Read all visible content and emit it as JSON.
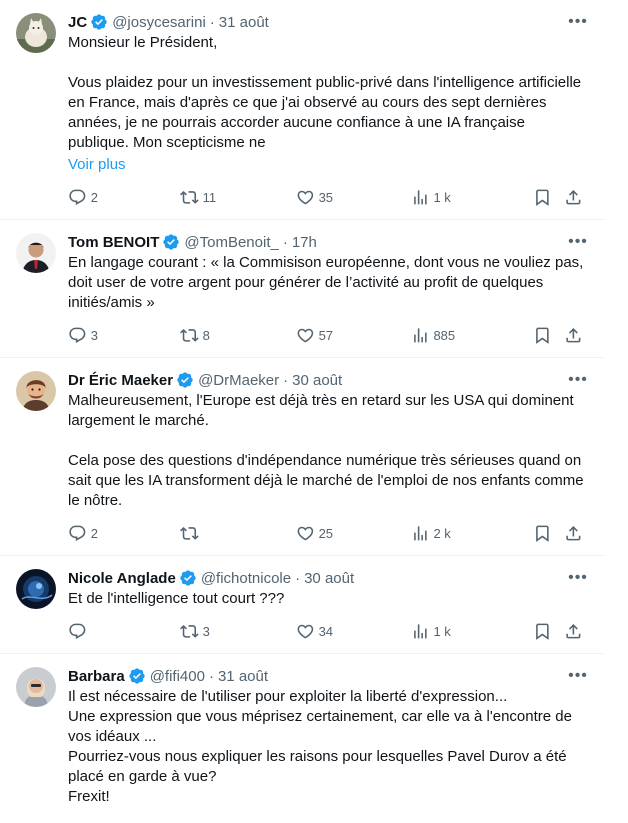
{
  "tweets": [
    {
      "name": "JC",
      "handle": "@josycesarini",
      "dot": "·",
      "time": "31 août",
      "text": "Monsieur le Président,\n\nVous plaidez pour un investissement public-privé dans l'intelligence artificielle en France, mais d'après ce que j'ai observé au cours des sept dernières années, je ne pourrais accorder aucune confiance à une IA française publique. Mon scepticisme ne",
      "show_more": "Voir plus",
      "replies": "2",
      "reposts": "11",
      "likes": "35",
      "views": "1 k",
      "avatar_icon": "cat-photo-avatar"
    },
    {
      "name": "Tom BENOIT",
      "handle": "@TomBenoit_",
      "dot": "·",
      "time": "17h",
      "text": "En langage courant : « la Commisison européenne, dont vous ne vouliez pas, doit user de votre argent pour générer de l’activité au profit de quelques initiés/amis »",
      "replies": "3",
      "reposts": "8",
      "likes": "57",
      "views": "885",
      "avatar_icon": "man-portrait-avatar"
    },
    {
      "name": "Dr Éric Maeker",
      "handle": "@DrMaeker",
      "dot": "·",
      "time": "30 août",
      "text": "Malheureusement, l'Europe est déjà très en retard sur les USA qui dominent largement le marché.\n\nCela pose des questions d'indépendance numérique très sérieuses quand on sait que les IA transforment déjà le marché de l'emploi de nos enfants comme le nôtre.",
      "replies": "2",
      "reposts": "",
      "likes": "25",
      "views": "2 k",
      "avatar_icon": "cartoon-man-avatar"
    },
    {
      "name": "Nicole Anglade",
      "handle": "@fichotnicole",
      "dot": "·",
      "time": "30 août",
      "text": "Et de l'intelligence tout court ???",
      "replies": "",
      "reposts": "3",
      "likes": "34",
      "views": "1 k",
      "avatar_icon": "dark-blue-avatar"
    },
    {
      "name": "Barbara",
      "handle": "@fifi400",
      "dot": "·",
      "time": "31 août",
      "text": "Il est nécessaire de l'utiliser pour exploiter la liberté d'expression...\nUne expression que vous méprisez certainement, car elle va à l'encontre de vos idéaux ...\nPourriez-vous nous expliquer les raisons pour lesquelles Pavel Durov a été placé en garde à vue?\nFrexit!",
      "avatar_icon": "woman-photo-avatar"
    }
  ],
  "colors": {
    "accent": "#1d9bf0",
    "muted": "#536471",
    "text": "#0f1419",
    "border": "#eff3f4"
  }
}
